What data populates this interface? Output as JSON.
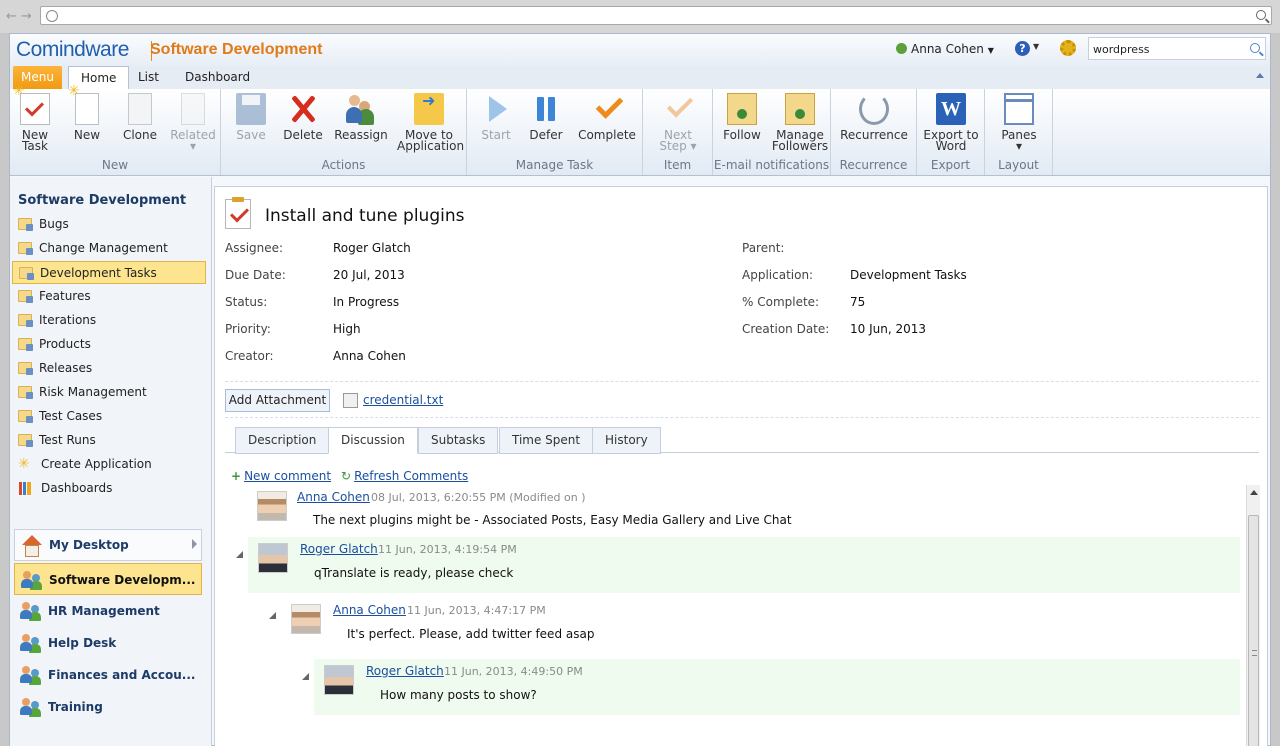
{
  "browser": {
    "nav_glyphs": "←→"
  },
  "header": {
    "logo": "Comindware",
    "workspace_title": "Software Development",
    "user_name": "Anna Cohen",
    "search_value": "wordpress"
  },
  "menubar": {
    "menu_label": "Menu",
    "tabs": [
      "Home",
      "List",
      "Dashboard"
    ]
  },
  "ribbon": {
    "groups": {
      "new": "New",
      "actions": "Actions",
      "manage_task": "Manage Task",
      "item": "Item",
      "email": "E-mail notifications",
      "recurrence": "Recurrence",
      "export": "Export",
      "layout": "Layout"
    },
    "buttons": {
      "new_task": "New\nTask",
      "new": "New",
      "clone": "Clone",
      "related": "Related",
      "save": "Save",
      "delete": "Delete",
      "reassign": "Reassign",
      "move": "Move to\nApplication",
      "start": "Start",
      "defer": "Defer",
      "complete": "Complete",
      "next_step": "Next\nStep",
      "follow": "Follow",
      "manage_followers": "Manage\nFollowers",
      "recurrence": "Recurrence",
      "export_word": "Export to\nWord",
      "panes": "Panes"
    }
  },
  "sidebar": {
    "title": "Software Development",
    "items": [
      "Bugs",
      "Change Management",
      "Development Tasks",
      "Features",
      "Iterations",
      "Products",
      "Releases",
      "Risk Management",
      "Test Cases",
      "Test Runs",
      "Create Application",
      "Dashboards"
    ],
    "selected_item": "Development Tasks",
    "desktop_label": "My Desktop",
    "workspaces": [
      "Software Developm...",
      "HR Management",
      "Help Desk",
      "Finances and Accou...",
      "Training"
    ]
  },
  "task": {
    "title": "Install and tune plugins",
    "fields_left": [
      {
        "label": "Assignee:",
        "value": "Roger Glatch"
      },
      {
        "label": "Due Date:",
        "value": "20 Jul, 2013"
      },
      {
        "label": "Status:",
        "value": "In Progress"
      },
      {
        "label": "Priority:",
        "value": "High"
      },
      {
        "label": "Creator:",
        "value": "Anna Cohen"
      }
    ],
    "fields_right": [
      {
        "label": "Parent:",
        "value": ""
      },
      {
        "label": "Application:",
        "value": "Development Tasks"
      },
      {
        "label": "% Complete:",
        "value": "75"
      },
      {
        "label": "Creation Date:",
        "value": "10 Jun, 2013"
      }
    ],
    "add_attachment": "Add Attachment",
    "attachment_file": "credential.txt",
    "tabs": [
      "Description",
      "Discussion",
      "Subtasks",
      "Time Spent",
      "History"
    ],
    "active_tab": "Discussion",
    "new_comment": "New comment",
    "refresh_comments": "Refresh Comments"
  },
  "comments": [
    {
      "author": "Anna Cohen",
      "meta": "08 Jul, 2013, 6:20:55 PM (Modified on )",
      "text": "The next plugins might be - Associated Posts, Easy Media Gallery and Live Chat"
    },
    {
      "author": "Roger Glatch",
      "meta": "11 Jun, 2013, 4:19:54 PM",
      "text": "qTranslate is ready, please check"
    },
    {
      "author": "Anna Cohen",
      "meta": "11 Jun, 2013, 4:47:17 PM",
      "text": "It's perfect. Please, add twitter feed asap"
    },
    {
      "author": "Roger Glatch",
      "meta": "11 Jun, 2013, 4:49:50 PM",
      "text": "How many posts to show?"
    }
  ]
}
